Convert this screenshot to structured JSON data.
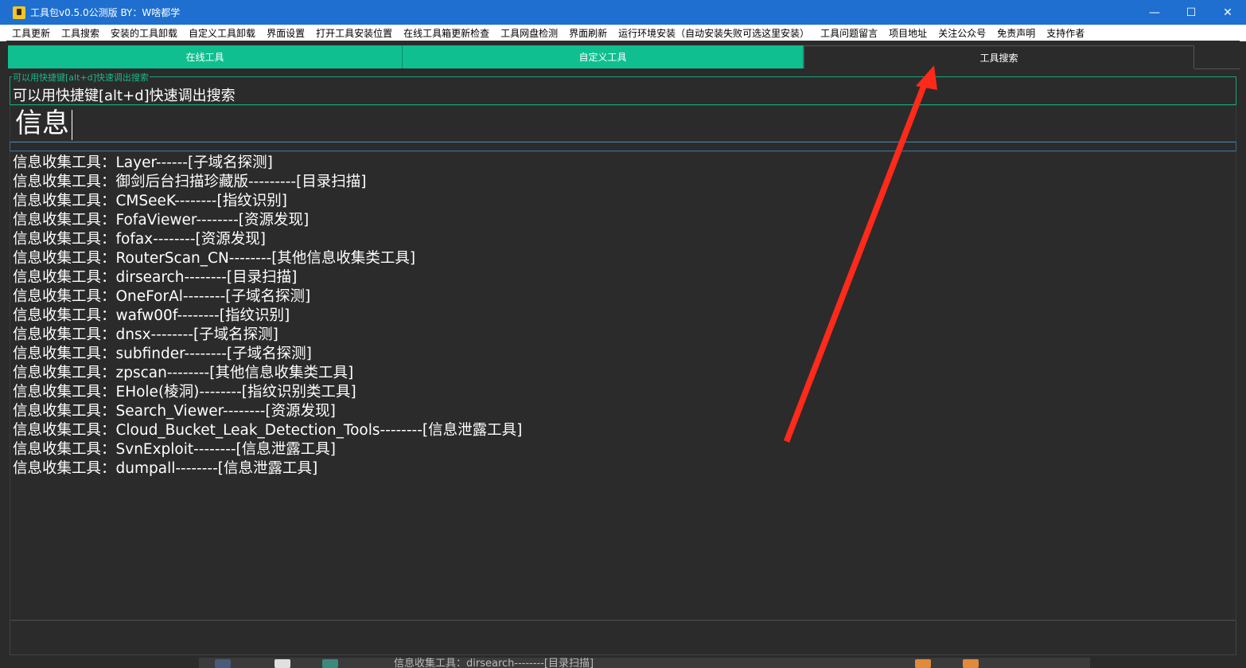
{
  "window": {
    "title": "工具包v0.5.0公测版  BY：W啥都学",
    "minimize_glyph": "—",
    "maximize_glyph": "☐",
    "close_glyph": "✕"
  },
  "menu": [
    "工具更新",
    "工具搜索",
    "安装的工具卸载",
    "自定义工具卸载",
    "界面设置",
    "打开工具安装位置",
    "在线工具箱更新检查",
    "工具网盘检测",
    "界面刷新",
    "运行环境安装（自动安装失败可选这里安装）",
    "工具问题留言",
    "项目地址",
    "关注公众号",
    "免责声明",
    "支持作者"
  ],
  "tabs": [
    {
      "label": "在线工具"
    },
    {
      "label": "自定义工具"
    },
    {
      "label": "工具搜索"
    }
  ],
  "search_group": {
    "title": "可以用快捷键[alt+d]快速调出搜索",
    "hint": "可以用快捷键[alt+d]快速调出搜索"
  },
  "search": {
    "value": "信息"
  },
  "results": [
    "信息收集工具：Layer------[子域名探测]",
    "信息收集工具：御剑后台扫描珍藏版---------[目录扫描]",
    "信息收集工具：CMSeeK--------[指纹识别]",
    "信息收集工具：FofaViewer--------[资源发现]",
    "信息收集工具：fofax--------[资源发现]",
    "信息收集工具：RouterScan_CN--------[其他信息收集类工具]",
    "信息收集工具：dirsearch--------[目录扫描]",
    "信息收集工具：OneForAl--------[子域名探测]",
    "信息收集工具：wafw00f--------[指纹识别]",
    "信息收集工具：dnsx--------[子域名探测]",
    "信息收集工具：subfinder--------[子域名探测]",
    "信息收集工具：zpscan--------[其他信息收集类工具]",
    "信息收集工具：EHole(棱洞)--------[指纹识别类工具]",
    "信息收集工具：Search_Viewer--------[资源发现]",
    "信息收集工具：Cloud_Bucket_Leak_Detection_Tools--------[信息泄露工具]",
    "信息收集工具：SvnExploit--------[信息泄露工具]",
    "信息收集工具：dumpall--------[信息泄露工具]"
  ],
  "background_window": {
    "text": "信息收集工具：dirsearch--------[目录扫描]"
  },
  "colors": {
    "title_bar": "#1e6fd0",
    "tab_green": "#0fbf8f",
    "background": "#2b2b2b",
    "arrow": "#ff2a1a"
  }
}
